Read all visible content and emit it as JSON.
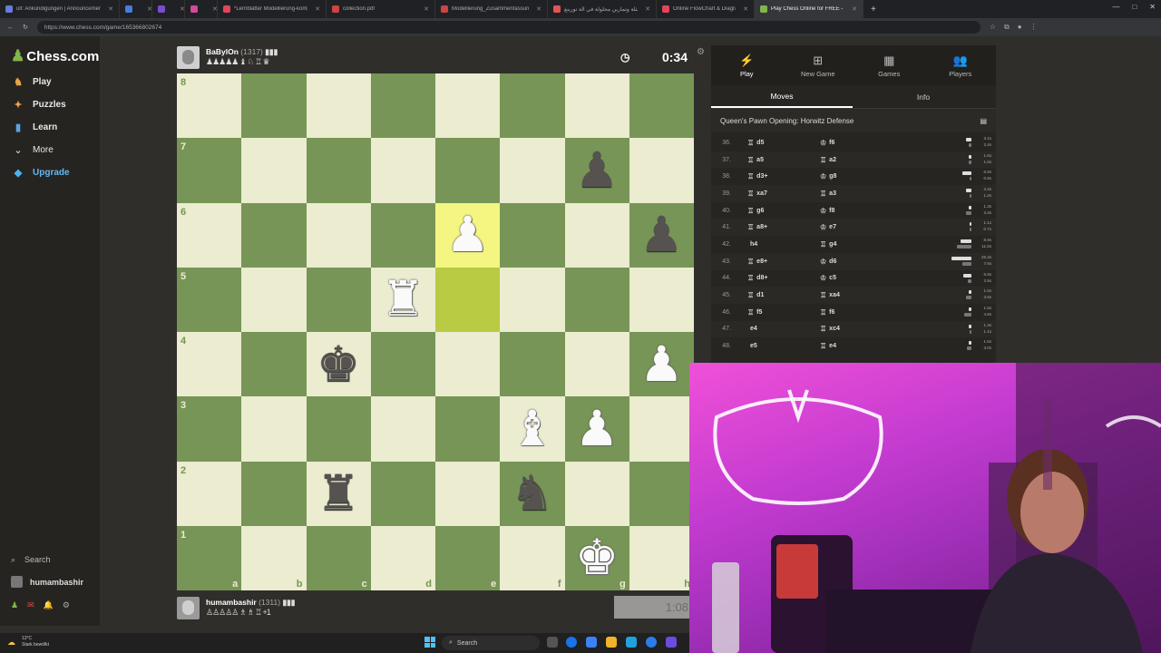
{
  "browser": {
    "tabs": [
      {
        "title": "ult: Ankündigungen | Announcement",
        "color": "#6b7bd8"
      },
      {
        "title": "",
        "color": "#4a7be0",
        "badge": true,
        "badge_color": "#3b6fd8"
      },
      {
        "title": "",
        "color": "#7b4bd0",
        "badge": true,
        "badge_color": "#9b4be0"
      },
      {
        "title": "",
        "color": "#d04b9b",
        "badge": true,
        "badge_color": "#c83b8b"
      },
      {
        "title": "*Lernblätter Modellierung-komp",
        "color": "#e0475b"
      },
      {
        "title": "collection.pdf",
        "color": "#c44"
      },
      {
        "title": "Modellierung_Zusammenfassung",
        "color": "#c44"
      },
      {
        "title": "أمثلة وتمارين محلولة في آلة تورينغ",
        "color": "#e05555"
      },
      {
        "title": "Online FlowChart & Diagrams Edit",
        "color": "#e0455b"
      },
      {
        "title": "Play Chess Online for FREE - 2 Pla",
        "color": "#81b64c",
        "active": true
      }
    ],
    "url": "https://www.chess.com/game/165366802674"
  },
  "sidebar": {
    "logo": "Chess.com",
    "items": [
      {
        "label": "Play",
        "icon": "play-icon"
      },
      {
        "label": "Puzzles",
        "icon": "puzzle-icon"
      },
      {
        "label": "Learn",
        "icon": "learn-icon"
      },
      {
        "label": "More",
        "icon": "chevron-down-icon"
      },
      {
        "label": "Upgrade",
        "icon": "diamond-icon"
      }
    ],
    "search_label": "Search",
    "username": "humambashir"
  },
  "players": {
    "top": {
      "name": "BaBylOn",
      "rating": "(1317)",
      "captured": "♟♟♟♟♟ ♝ ♘ ♖ ♛"
    },
    "bottom": {
      "name": "humambashir",
      "rating": "(1311)",
      "captured": "♙♙♙♙♙ ♗ ♗ ♖ +1"
    }
  },
  "clocks": {
    "top": "0:34",
    "bottom": "1:08"
  },
  "board": {
    "files": [
      "a",
      "b",
      "c",
      "d",
      "e",
      "f",
      "g",
      "h"
    ],
    "ranks": [
      "8",
      "7",
      "6",
      "5",
      "4",
      "3",
      "2",
      "1"
    ],
    "highlight_squares": [
      "e6",
      "e5"
    ],
    "pieces": [
      {
        "sq": "g7",
        "glyph": "♟",
        "color": "b"
      },
      {
        "sq": "e6",
        "glyph": "♟",
        "color": "w"
      },
      {
        "sq": "h6",
        "glyph": "♟",
        "color": "b"
      },
      {
        "sq": "d5",
        "glyph": "♜",
        "color": "w"
      },
      {
        "sq": "c4",
        "glyph": "♚",
        "color": "b"
      },
      {
        "sq": "h4",
        "glyph": "♟",
        "color": "w"
      },
      {
        "sq": "f3",
        "glyph": "♝",
        "color": "w"
      },
      {
        "sq": "g3",
        "glyph": "♟",
        "color": "w"
      },
      {
        "sq": "c2",
        "glyph": "♜",
        "color": "b"
      },
      {
        "sq": "f2",
        "glyph": "♞",
        "color": "b"
      },
      {
        "sq": "g1",
        "glyph": "♚",
        "color": "w"
      }
    ]
  },
  "panel": {
    "tabs": [
      {
        "label": "Play",
        "icon": "⚡",
        "active": true
      },
      {
        "label": "New Game",
        "icon": "⊞"
      },
      {
        "label": "Games",
        "icon": "▦"
      },
      {
        "label": "Players",
        "icon": "👥"
      }
    ],
    "subtabs": [
      "Moves",
      "Info"
    ],
    "opening": "Queen's Pawn Opening: Horwitz Defense",
    "moves": [
      {
        "n": "36.",
        "w": "d5",
        "wp": "♖",
        "b": "f6",
        "bp": "♔",
        "tw": "3.1s",
        "tb": "2.4s",
        "ww": 6,
        "bw": 3
      },
      {
        "n": "37.",
        "w": "a5",
        "wp": "♖",
        "b": "a2",
        "bp": "♖",
        "tw": "1.6s",
        "tb": "1.6s",
        "ww": 3,
        "bw": 3
      },
      {
        "n": "38.",
        "w": "d3+",
        "wp": "♖",
        "b": "g8",
        "bp": "♔",
        "tw": "6.9s",
        "tb": "0.9s",
        "ww": 10,
        "bw": 2
      },
      {
        "n": "39.",
        "w": "xa7",
        "wp": "♖",
        "b": "a3",
        "bp": "♖",
        "tw": "3.4s",
        "tb": "1.2s",
        "ww": 6,
        "bw": 2
      },
      {
        "n": "40.",
        "w": "g6",
        "wp": "♖",
        "b": "f8",
        "bp": "♔",
        "tw": "1.3s",
        "tb": "3.3s",
        "ww": 3,
        "bw": 6
      },
      {
        "n": "41.",
        "w": "a8+",
        "wp": "♖",
        "b": "e7",
        "bp": "♔",
        "tw": "1.1s",
        "tb": "0.7s",
        "ww": 2,
        "bw": 2
      },
      {
        "n": "42.",
        "w": "h4",
        "wp": "",
        "b": "g4",
        "bp": "♖",
        "tw": "8.9s",
        "tb": "11.5s",
        "ww": 12,
        "bw": 16
      },
      {
        "n": "43.",
        "w": "e8+",
        "wp": "♖",
        "b": "d6",
        "bp": "♔",
        "tw": "25.4s",
        "tb": "7.6s",
        "ww": 22,
        "bw": 10
      },
      {
        "n": "44.",
        "w": "d8+",
        "wp": "♖",
        "b": "c5",
        "bp": "♔",
        "tw": "5.9s",
        "tb": "2.5s",
        "ww": 9,
        "bw": 4
      },
      {
        "n": "45.",
        "w": "d1",
        "wp": "♖",
        "b": "xa4",
        "bp": "♖",
        "tw": "1.5s",
        "tb": "3.6s",
        "ww": 3,
        "bw": 6
      },
      {
        "n": "46.",
        "w": "f5",
        "wp": "♖",
        "b": "f6",
        "bp": "♖",
        "tw": "1.5s",
        "tb": "4.9s",
        "ww": 3,
        "bw": 8
      },
      {
        "n": "47.",
        "w": "e4",
        "wp": "",
        "b": "xc4",
        "bp": "♖",
        "tw": "1.3s",
        "tb": "1.1s",
        "ww": 3,
        "bw": 2
      },
      {
        "n": "48.",
        "w": "e5",
        "wp": "",
        "b": "e4",
        "bp": "♖",
        "tw": "1.5s",
        "tb": "3.0s",
        "ww": 3,
        "bw": 5
      }
    ]
  },
  "taskbar": {
    "weather_temp": "13°C",
    "weather_text": "Stark bewölkt",
    "search": "Search"
  }
}
